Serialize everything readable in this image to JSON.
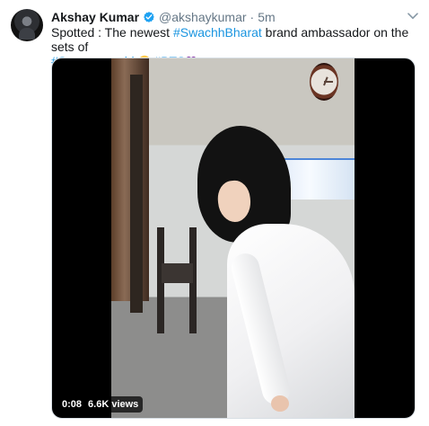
{
  "tweet": {
    "author_name": "Akshay Kumar",
    "author_handle": "@akshaykumar",
    "separator": "·",
    "timestamp": "5m",
    "text": {
      "part1": "Spotted : The newest ",
      "hashtag1": "#SwachhBharat",
      "part2": " brand ambassador on the sets of ",
      "hashtag2": "#Sooryavanshi",
      "part3": " ",
      "hashtag3": "#BTS"
    },
    "icons": {
      "verified": "verified-badge-icon",
      "caret": "chevron-down-icon",
      "emoji": "grinning-face-icon",
      "purple_heart": "purple-heart-icon"
    }
  },
  "video": {
    "duration": "0:08",
    "views": "6.6K views"
  },
  "colors": {
    "link": "#1b95e0",
    "text": "#14171a",
    "secondary": "#657786",
    "verified": "#1da1f2"
  }
}
